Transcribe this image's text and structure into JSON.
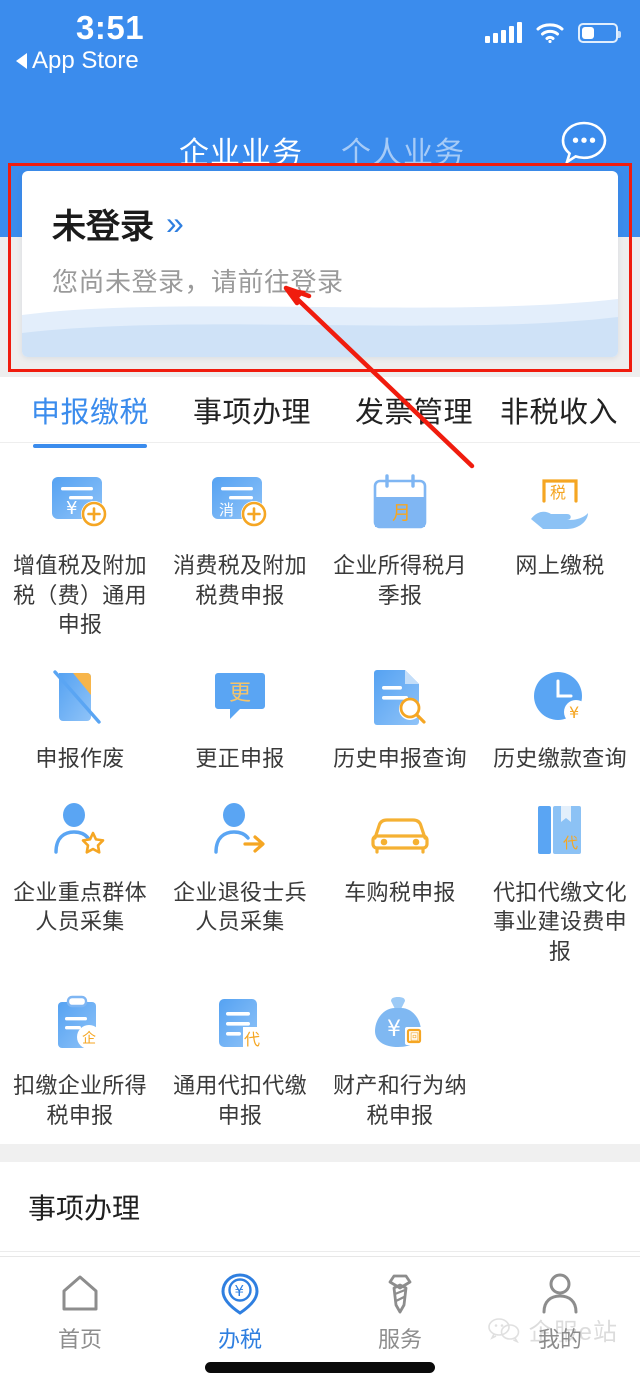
{
  "status_bar": {
    "time": "3:51",
    "back_label": "App Store",
    "signal_icon": "signal-bars-icon",
    "wifi_icon": "wifi-icon",
    "battery_icon": "battery-icon",
    "battery_level_percent": 35
  },
  "header": {
    "tabs": [
      {
        "label": "企业业务",
        "active": true
      },
      {
        "label": "个人业务",
        "active": false
      }
    ],
    "chat_icon": "chat-bubble-icon",
    "background_color": "#3b8ced"
  },
  "login_card": {
    "title": "未登录",
    "chevron": "»",
    "subtitle": "您尚未登录，请前往登录"
  },
  "annotation": {
    "box_color": "#f01c0e",
    "arrow_color": "#f01c0e"
  },
  "category_tabs": [
    {
      "label": "申报缴税",
      "active": true
    },
    {
      "label": "事项办理",
      "active": false
    },
    {
      "label": "发票管理",
      "active": false
    },
    {
      "label": "非税收入",
      "active": false
    }
  ],
  "services": [
    {
      "label": "增值税及附加税（费）通用申报",
      "icon": "invoice-yuan-add-icon"
    },
    {
      "label": "消费税及附加税费申报",
      "icon": "invoice-consumption-add-icon"
    },
    {
      "label": "企业所得税月季报",
      "icon": "calendar-month-icon"
    },
    {
      "label": "网上缴税",
      "icon": "hand-tax-icon"
    },
    {
      "label": "申报作废",
      "icon": "document-void-icon"
    },
    {
      "label": "更正申报",
      "icon": "speech-correct-icon"
    },
    {
      "label": "历史申报查询",
      "icon": "document-search-icon"
    },
    {
      "label": "历史缴款查询",
      "icon": "clock-yuan-icon"
    },
    {
      "label": "企业重点群体人员采集",
      "icon": "person-star-icon"
    },
    {
      "label": "企业退役士兵人员采集",
      "icon": "person-arrow-icon"
    },
    {
      "label": "车购税申报",
      "icon": "car-icon"
    },
    {
      "label": "代扣代缴文化事业建设费申报",
      "icon": "book-dai-icon"
    },
    {
      "label": "扣缴企业所得税申报",
      "icon": "clipboard-qi-icon"
    },
    {
      "label": "通用代扣代缴申报",
      "icon": "document-dai-icon"
    },
    {
      "label": "财产和行为纳税申报",
      "icon": "money-bag-icon"
    }
  ],
  "section_two": {
    "title": "事项办理",
    "partial_icons": [
      "two-blue-squares-icon",
      "blue-circle-icon",
      "orange-dot-arc-icon",
      "blue-square-stripes-icon"
    ]
  },
  "bottom_nav": [
    {
      "label": "首页",
      "icon": "home-icon",
      "active": false
    },
    {
      "label": "办税",
      "icon": "pin-yuan-icon",
      "active": true
    },
    {
      "label": "服务",
      "icon": "tie-icon",
      "active": false
    },
    {
      "label": "我的",
      "icon": "person-icon",
      "active": false
    }
  ],
  "watermark": {
    "text": "企服e站",
    "icon": "wechat-icon"
  },
  "colors": {
    "brand_blue": "#3b8ced",
    "accent_blue": "#2f7fe0",
    "accent_orange": "#f5a623",
    "annotation_red": "#f01c0e"
  }
}
